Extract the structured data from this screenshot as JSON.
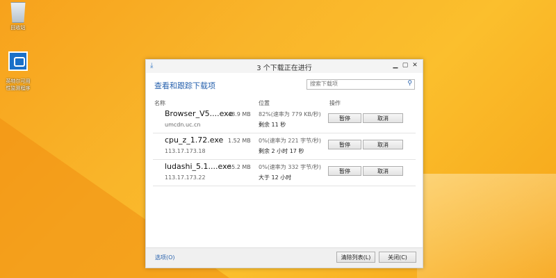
{
  "desktop": {
    "icons": [
      {
        "label": "回收站",
        "icon": "recycle-bin-icon"
      },
      {
        "label": "英特尔可用\n性监测程序",
        "icon": "sniffer-icon"
      }
    ]
  },
  "window": {
    "title": "3 个下载正在进行",
    "header": "查看和跟踪下载项",
    "search_placeholder": "搜索下载项",
    "columns": {
      "name": "名称",
      "location": "位置",
      "actions": "操作"
    },
    "downloads": [
      {
        "name": "Browser_V5....exe",
        "host": "umcdn.uc.cn",
        "size": "48.9 MB",
        "progress": "82%(速率为 779 KB/秒)",
        "remaining": "剩余 11 秒",
        "pause": "暂停",
        "cancel": "取消"
      },
      {
        "name": "cpu_z_1.72.exe",
        "host": "113.17.173.18",
        "size": "1.52 MB",
        "progress": "0%(速率为 221 字节/秒)",
        "remaining": "剩余 2 小时 17 秒",
        "pause": "暂停",
        "cancel": "取消"
      },
      {
        "name": "ludashi_5.1....exe",
        "host": "113.17.173.22",
        "size": "55.2 MB",
        "progress": "0%(速率为 332 字节/秒)",
        "remaining": "大于 12 小时",
        "pause": "暂停",
        "cancel": "取消"
      }
    ],
    "footer": {
      "options": "选项(O)",
      "clear": "清除列表(L)",
      "close": "关闭(C)"
    }
  }
}
